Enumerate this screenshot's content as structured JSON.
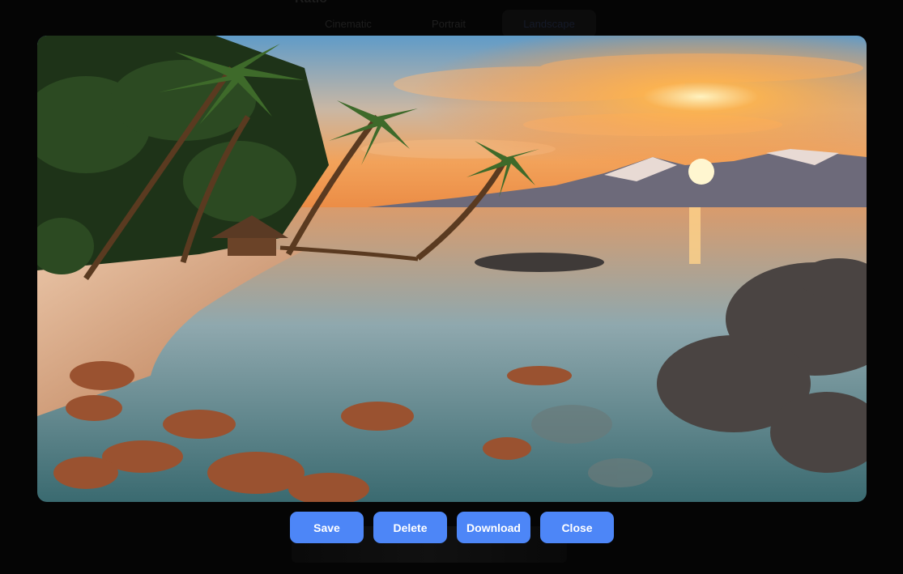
{
  "background": {
    "heading": "Ratio",
    "tabs": [
      {
        "label": "Cinematic",
        "active": false
      },
      {
        "label": "Portrait",
        "active": false
      },
      {
        "label": "Landscape",
        "active": true
      }
    ]
  },
  "viewer": {
    "image_description_icon": "generated-image"
  },
  "actions": {
    "save_label": "Save",
    "delete_label": "Delete",
    "download_label": "Download",
    "close_label": "Close"
  },
  "colors": {
    "button": "#4d86f7",
    "overlay": "#000000"
  }
}
